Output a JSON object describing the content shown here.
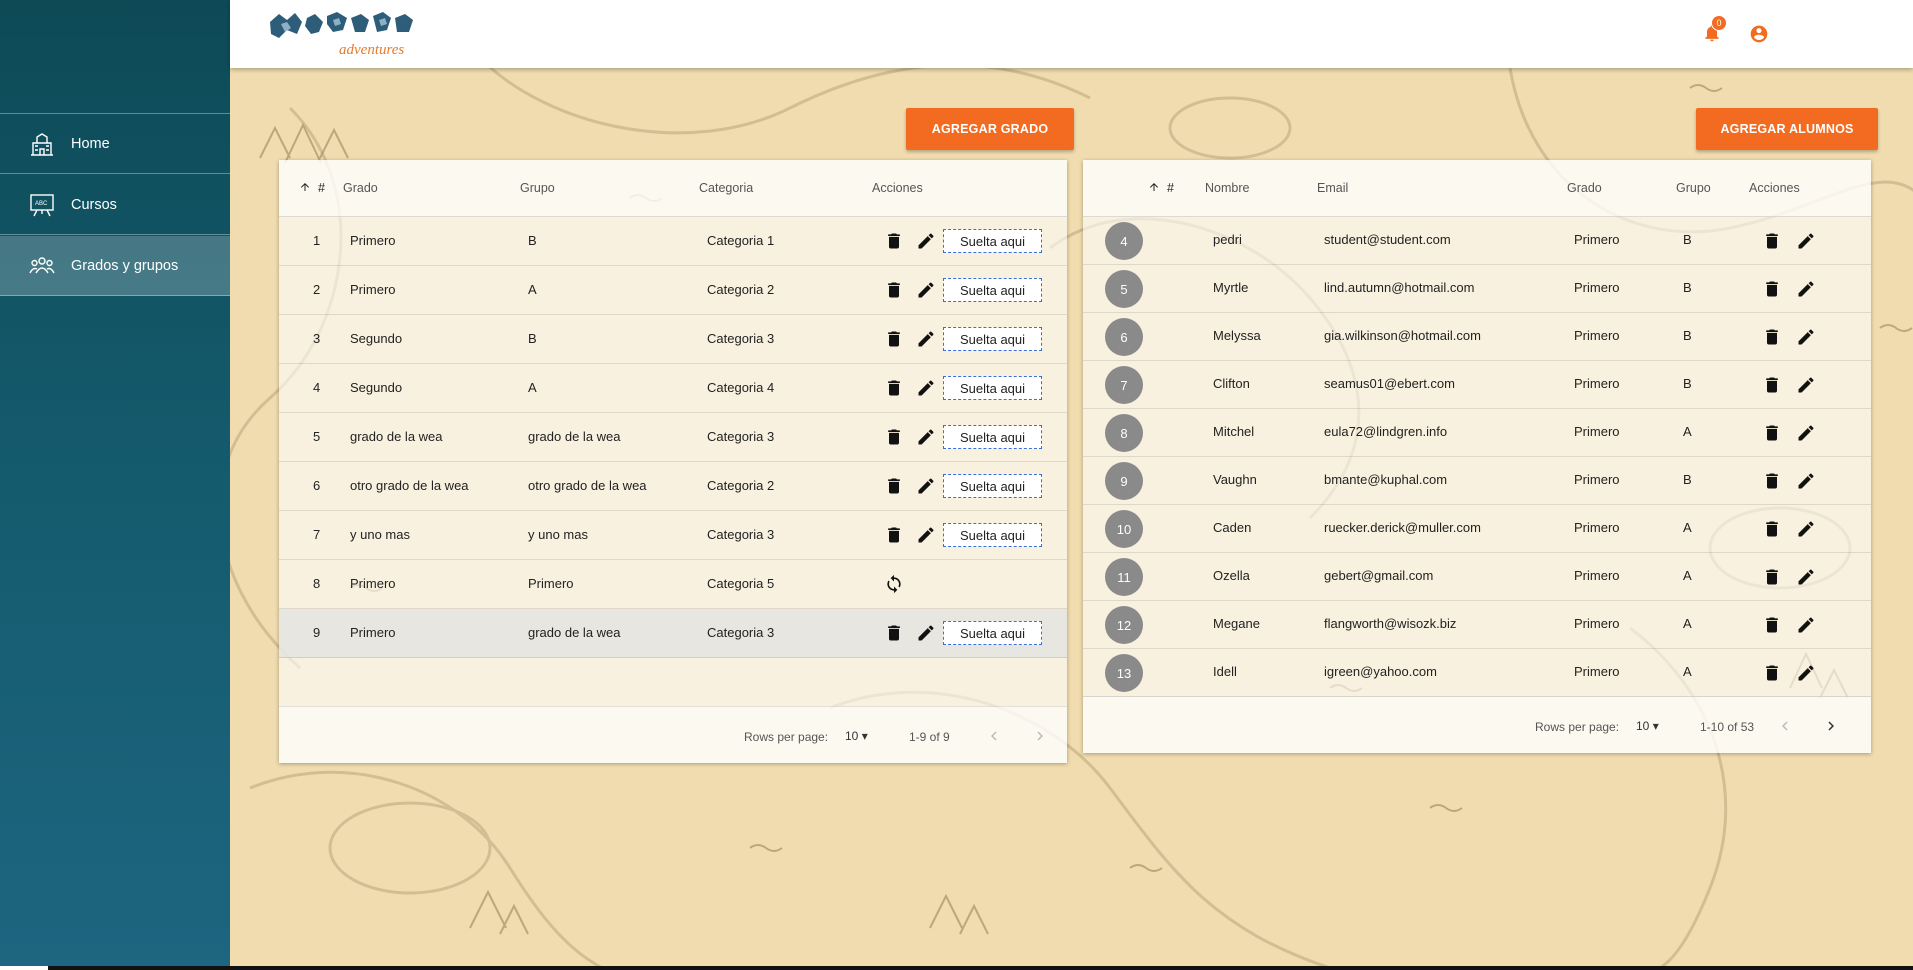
{
  "brand": {
    "logo_text": "adventures"
  },
  "header": {
    "notifications_count": "0"
  },
  "sidebar": {
    "items": [
      {
        "label": "Home",
        "icon": "school-building-icon"
      },
      {
        "label": "Cursos",
        "icon": "abc-board-icon"
      },
      {
        "label": "Grados y grupos",
        "icon": "people-group-icon"
      }
    ]
  },
  "grades": {
    "add_button": "AGREGAR GRADO",
    "columns": [
      "#",
      "Grado",
      "Grupo",
      "Categoria",
      "Acciones"
    ],
    "drop_label": "Suelta aqui",
    "rows": [
      {
        "n": "1",
        "grado": "Primero",
        "grupo": "B",
        "categoria": "Categoria 1",
        "sync": false
      },
      {
        "n": "2",
        "grado": "Primero",
        "grupo": "A",
        "categoria": "Categoria 2",
        "sync": false
      },
      {
        "n": "3",
        "grado": "Segundo",
        "grupo": "B",
        "categoria": "Categoria 3",
        "sync": false
      },
      {
        "n": "4",
        "grado": "Segundo",
        "grupo": "A",
        "categoria": "Categoria 4",
        "sync": false
      },
      {
        "n": "5",
        "grado": "grado de la wea",
        "grupo": "grado de la wea",
        "categoria": "Categoria 3",
        "sync": false
      },
      {
        "n": "6",
        "grado": "otro grado de la wea",
        "grupo": "otro grado de la wea",
        "categoria": "Categoria 2",
        "sync": false
      },
      {
        "n": "7",
        "grado": "y uno mas",
        "grupo": "y uno mas",
        "categoria": "Categoria 3",
        "sync": false
      },
      {
        "n": "8",
        "grado": "Primero",
        "grupo": "Primero",
        "categoria": "Categoria 5",
        "sync": true
      },
      {
        "n": "9",
        "grado": "Primero",
        "grupo": "grado de la wea",
        "categoria": "Categoria 3",
        "sync": false
      }
    ],
    "footer": {
      "rows_per_page_label": "Rows per page:",
      "rows_per_page": "10",
      "range": "1-9 of 9"
    }
  },
  "students": {
    "add_button": "AGREGAR ALUMNOS",
    "columns": [
      "#",
      "Nombre",
      "Email",
      "Grado",
      "Grupo",
      "Acciones"
    ],
    "rows": [
      {
        "n": "4",
        "nombre": "pedri",
        "email": "student@student.com",
        "grado": "Primero",
        "grupo": "B"
      },
      {
        "n": "5",
        "nombre": "Myrtle",
        "email": "lind.autumn@hotmail.com",
        "grado": "Primero",
        "grupo": "B"
      },
      {
        "n": "6",
        "nombre": "Melyssa",
        "email": "gia.wilkinson@hotmail.com",
        "grado": "Primero",
        "grupo": "B"
      },
      {
        "n": "7",
        "nombre": "Clifton",
        "email": "seamus01@ebert.com",
        "grado": "Primero",
        "grupo": "B"
      },
      {
        "n": "8",
        "nombre": "Mitchel",
        "email": "eula72@lindgren.info",
        "grado": "Primero",
        "grupo": "A"
      },
      {
        "n": "9",
        "nombre": "Vaughn",
        "email": "bmante@kuphal.com",
        "grado": "Primero",
        "grupo": "B"
      },
      {
        "n": "10",
        "nombre": "Caden",
        "email": "ruecker.derick@muller.com",
        "grado": "Primero",
        "grupo": "A"
      },
      {
        "n": "11",
        "nombre": "Ozella",
        "email": "gebert@gmail.com",
        "grado": "Primero",
        "grupo": "A"
      },
      {
        "n": "12",
        "nombre": "Megane",
        "email": "flangworth@wisozk.biz",
        "grado": "Primero",
        "grupo": "A"
      },
      {
        "n": "13",
        "nombre": "Idell",
        "email": "igreen@yahoo.com",
        "grado": "Primero",
        "grupo": "A"
      }
    ],
    "footer": {
      "rows_per_page_label": "Rows per page:",
      "rows_per_page": "10",
      "range": "1-10 of 53"
    }
  },
  "colors": {
    "accent": "#f26b21",
    "sidebar": "#145a6c",
    "map": "#f0dcae",
    "badge": "#8a8a8a"
  }
}
